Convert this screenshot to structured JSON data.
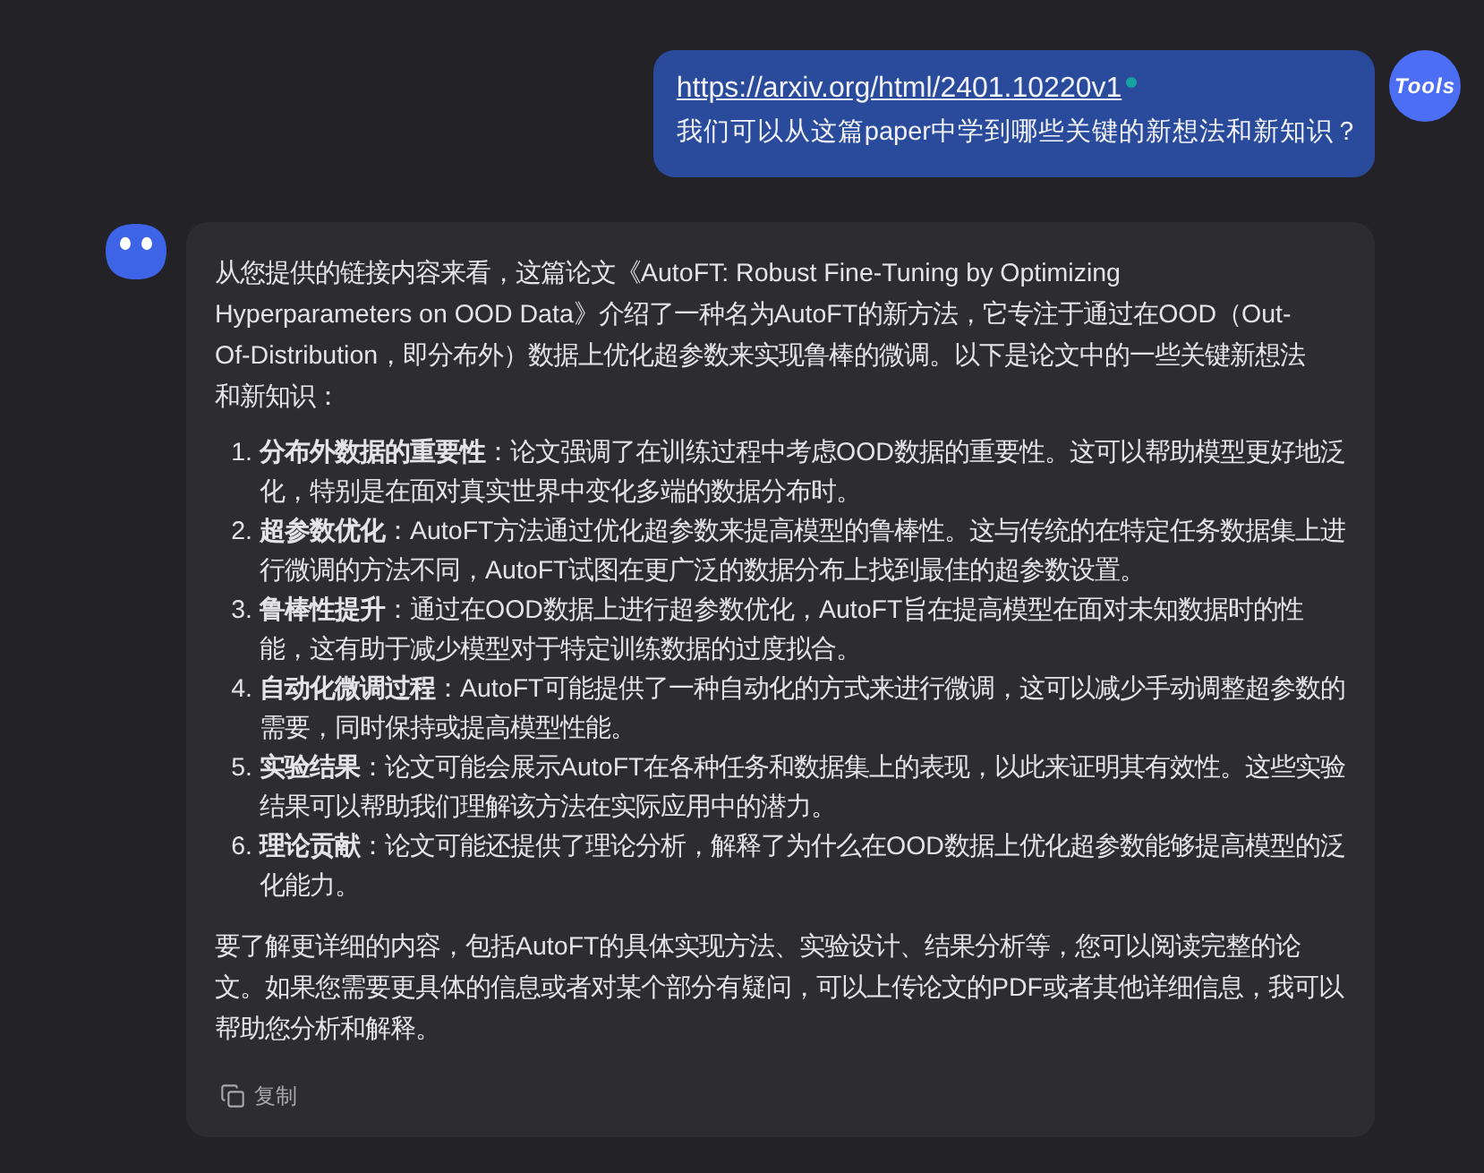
{
  "user_message": {
    "link": "https://arxiv.org/html/2401.10220v1",
    "text": "我们可以从这篇paper中学到哪些关键的新想法和新知识？",
    "avatar_label": "Tools"
  },
  "assistant_message": {
    "intro": "从您提供的链接内容来看，这篇论文《AutoFT: Robust Fine-Tuning by Optimizing Hyperparameters on OOD Data》介绍了一种名为AutoFT的新方法，它专注于通过在OOD（Out-Of-Distribution，即分布外）数据上优化超参数来实现鲁棒的微调。以下是论文中的一些关键新想法和新知识：",
    "points": [
      {
        "number": "1.",
        "text": "**分布外数据的重要性**：论文强调了在训练过程中考虑OOD数据的重要性。这可以帮助模型更好地泛化，特别是在面对真实世界中变化多端的数据分布时。"
      },
      {
        "number": "2.",
        "text": "**超参数优化**：AutoFT方法通过优化超参数来提高模型的鲁棒性。这与传统的在特定任务数据集上进行微调的方法不同，AutoFT试图在更广泛的数据分布上找到最佳的超参数设置。"
      },
      {
        "number": "3.",
        "text": "**鲁棒性提升**：通过在OOD数据上进行超参数优化，AutoFT旨在提高模型在面对未知数据时的性能，这有助于减少模型对于特定训练数据的过度拟合。"
      },
      {
        "number": "4.",
        "text": "**自动化微调过程**：AutoFT可能提供了一种自动化的方式来进行微调，这可以减少手动调整超参数的需要，同时保持或提高模型性能。"
      },
      {
        "number": "5.",
        "text": "**实验结果**：论文可能会展示AutoFT在各种任务和数据集上的表现，以此来证明其有效性。这些实验结果可以帮助我们理解该方法在实际应用中的潜力。"
      },
      {
        "number": "6.",
        "text": "**理论贡献**：论文可能还提供了理论分析，解释了为什么在OOD数据上优化超参数能够提高模型的泛化能力。"
      }
    ],
    "closing": "要了解更详细的内容，包括AutoFT的具体实现方法、实验设计、结果分析等，您可以阅读完整的论文。如果您需要更具体的信息或者对某个部分有疑问，可以上传论文的PDF或者其他详细信息，我可以帮助您分析和解释。",
    "actions": [
      {
        "kind": "copy",
        "label": "复制"
      }
    ]
  }
}
